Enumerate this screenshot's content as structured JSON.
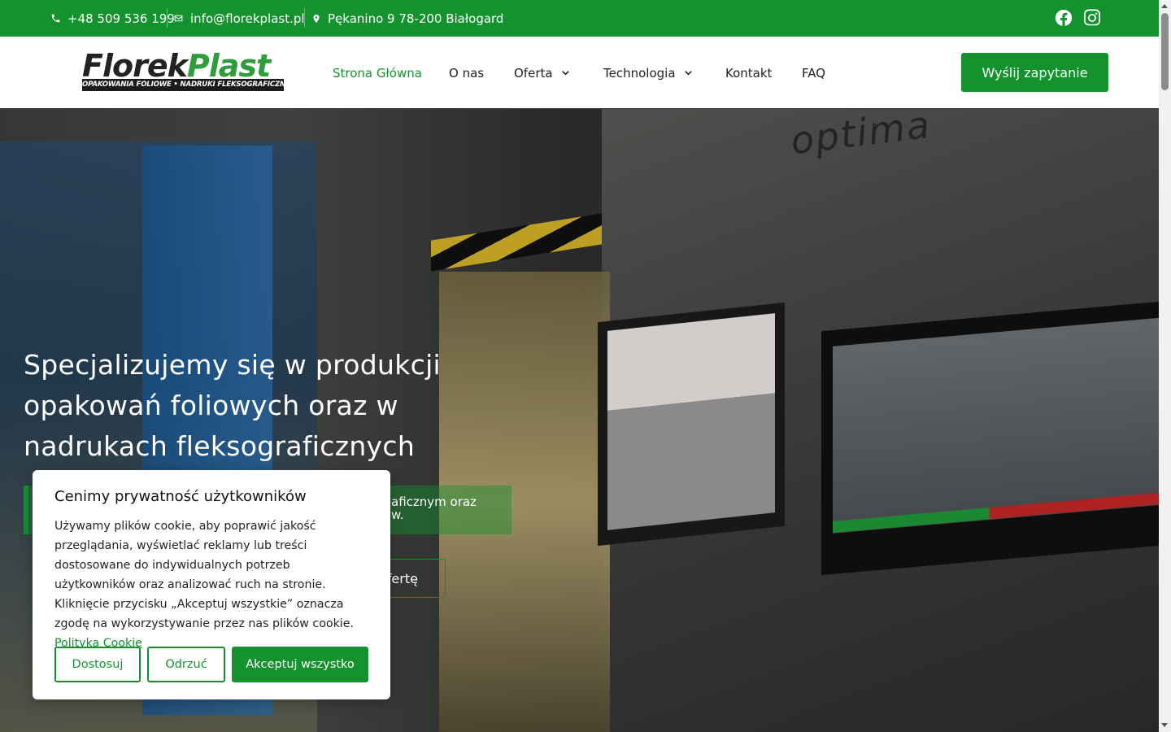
{
  "topbar": {
    "phone": "+48 509 536 199",
    "email": "info@florekplast.pl",
    "address": "Pękanino 9 78-200 Białogard"
  },
  "header": {
    "logo_word_a": "Florek",
    "logo_word_b": "Plast",
    "logo_tagline": "OPAKOWANIA FOLIOWE • NADRUKI FLEKSOGRAFICZNE",
    "nav": {
      "home": "Strona Główna",
      "about": "O nas",
      "offer": "Oferta",
      "technology": "Technologia",
      "contact": "Kontakt",
      "faq": "FAQ"
    },
    "cta": "Wyślij zapytanie"
  },
  "hero": {
    "brand_text": "optima",
    "headline": "Specjalizujemy się w produkcji opakowań foliowych oraz w nadrukach fleksograficznych",
    "lead_visible": "aficznym oraz",
    "lead_visible_2": "w.",
    "button_visible": "ofertę"
  },
  "cookie": {
    "title": "Cenimy prywatność użytkowników",
    "body": "Używamy plików cookie, aby poprawić jakość przeglądania, wyświetlać reklamy lub treści dostosowane do indywidualnych potrzeb użytkowników oraz analizować ruch na stronie. Kliknięcie przycisku „Akceptuj wszystkie” oznacza zgodę na wykorzystywanie przez nas plików cookie.",
    "policy_link": "Polityka Cookie",
    "customize": "Dostosuj",
    "reject": "Odrzuć",
    "accept": "Akceptuj wszystko"
  },
  "colors": {
    "brand_green": "#14922e"
  }
}
